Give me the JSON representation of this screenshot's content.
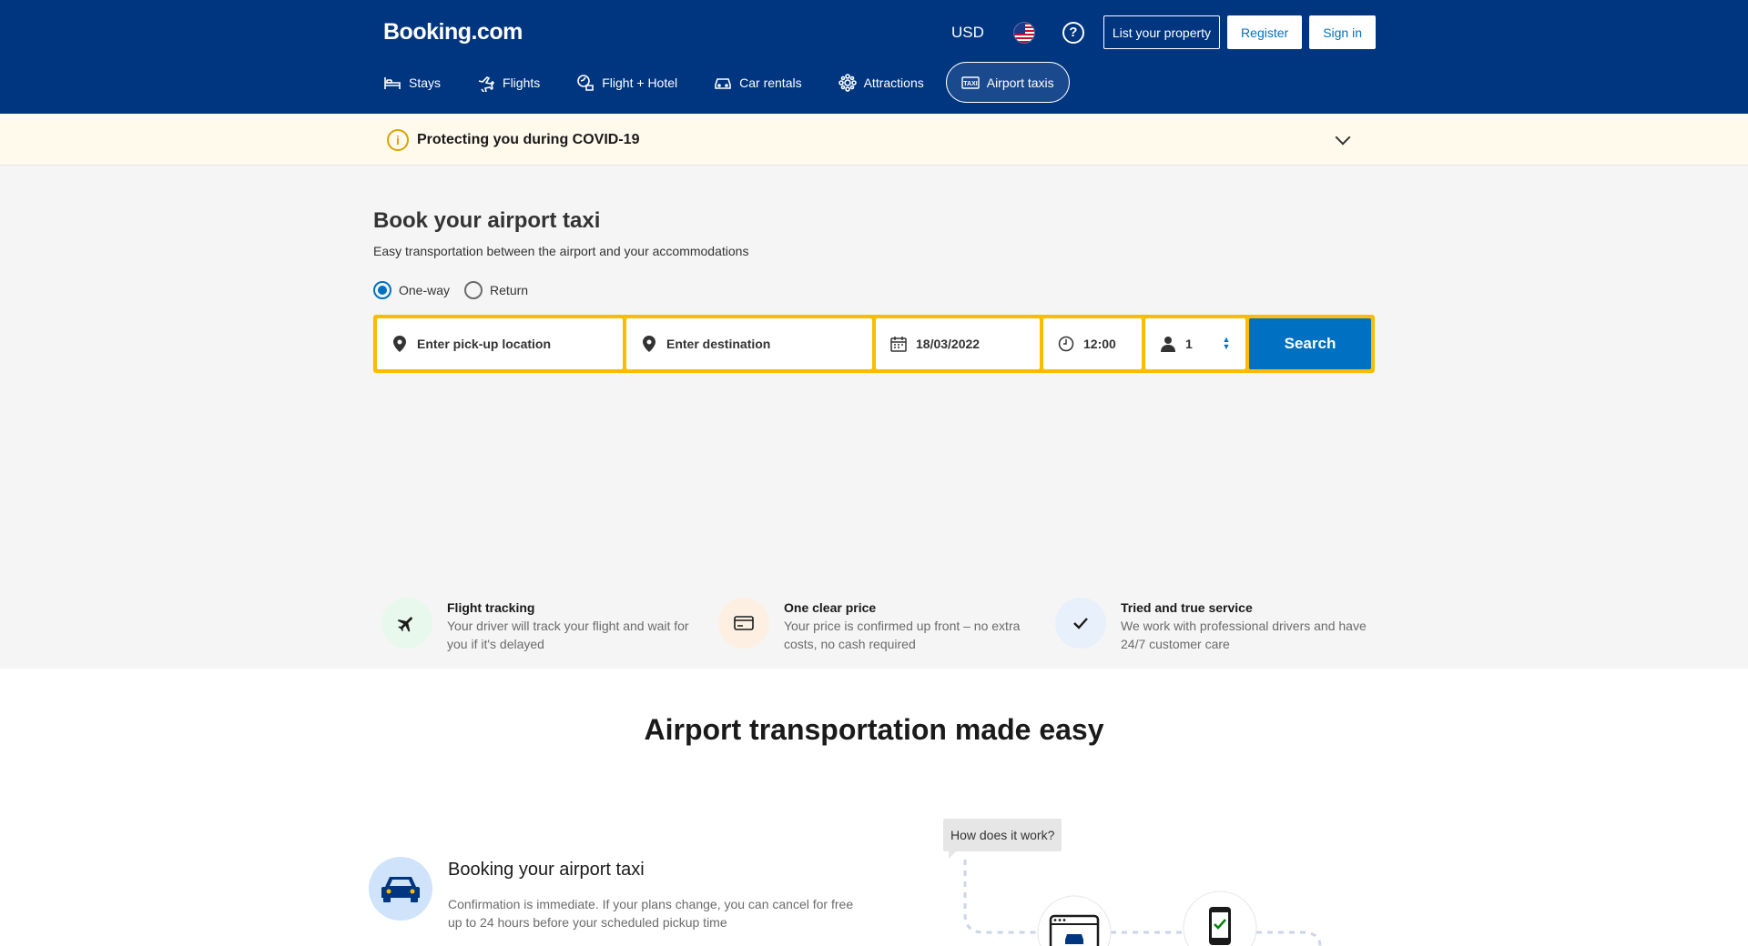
{
  "header": {
    "logo": "Booking.com",
    "currency": "USD",
    "flag_icon": "us-flag-icon",
    "help_icon": "help-icon",
    "list_property": "List your property",
    "register": "Register",
    "sign_in": "Sign in",
    "nav": [
      {
        "label": "Stays",
        "icon": "bed-icon"
      },
      {
        "label": "Flights",
        "icon": "plane-icon"
      },
      {
        "label": "Flight + Hotel",
        "icon": "flight-hotel-icon"
      },
      {
        "label": "Car rentals",
        "icon": "car-icon"
      },
      {
        "label": "Attractions",
        "icon": "attractions-icon"
      },
      {
        "label": "Airport taxis",
        "icon": "taxi-icon",
        "active": true
      }
    ]
  },
  "covid": {
    "title": "Protecting you during COVID-19"
  },
  "hero": {
    "title": "Book your airport taxi",
    "subtitle": "Easy transportation between the airport and your accommodations",
    "trip_types": [
      {
        "label": "One-way",
        "selected": true
      },
      {
        "label": "Return",
        "selected": false
      }
    ],
    "search": {
      "pickup_placeholder": "Enter pick-up location",
      "destination_placeholder": "Enter destination",
      "date": "18/03/2022",
      "time": "12:00",
      "passengers": "1",
      "button": "Search"
    },
    "features": [
      {
        "title": "Flight tracking",
        "text": "Your driver will track your flight and wait for you if it's delayed",
        "icon": "plane-icon"
      },
      {
        "title": "One clear price",
        "text": "Your price is confirmed up front – no extra costs, no cash required",
        "icon": "credit-card-icon"
      },
      {
        "title": "Tried and true service",
        "text": "We work with professional drivers and have 24/7 customer care",
        "icon": "checkmark-icon"
      }
    ]
  },
  "lower": {
    "title": "Airport transportation made easy",
    "step": {
      "title": "Booking your airport taxi",
      "text": "Confirmation is immediate. If your plans change, you can cancel for free up to 24 hours before your scheduled pickup time"
    },
    "how": "How does it work?"
  },
  "colors": {
    "brand_blue": "#003580",
    "accent_blue": "#0071c2",
    "search_border": "#febb02"
  }
}
